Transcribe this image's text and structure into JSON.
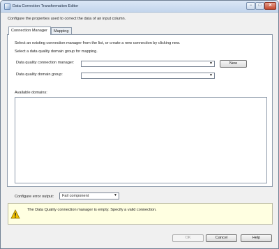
{
  "window": {
    "title": "Data Correction Transformation Editor",
    "controls": {
      "minimize": "−",
      "maximize": "□",
      "close": "✕"
    }
  },
  "description": "Configure the properties used to correct the data of an input column.",
  "tabs": [
    {
      "label": "Connection Manager",
      "active": true
    },
    {
      "label": "Mapping",
      "active": false
    }
  ],
  "connection_tab": {
    "instruction_1": "Select an existing connection manager from the list, or create a new connection by clicking new.",
    "instruction_2": "Select a data quality domain group for mapping.",
    "conn_manager_label": "Data quality connection manager:",
    "conn_manager_value": "",
    "domain_group_label": "Data quality domain group:",
    "domain_group_value": "",
    "new_button": "New",
    "available_domains_label": "Available domains:"
  },
  "error_output": {
    "label": "Configure error output:",
    "value": "Fail component"
  },
  "warning": {
    "icon": "warning-icon",
    "message": "The Data Quality connection manager is empty. Specify a valid connection."
  },
  "buttons": {
    "ok": "OK",
    "cancel": "Cancel",
    "help": "Help"
  },
  "colors": {
    "warning_bg": "#ffffe1",
    "warning_icon": "#f2c200"
  }
}
